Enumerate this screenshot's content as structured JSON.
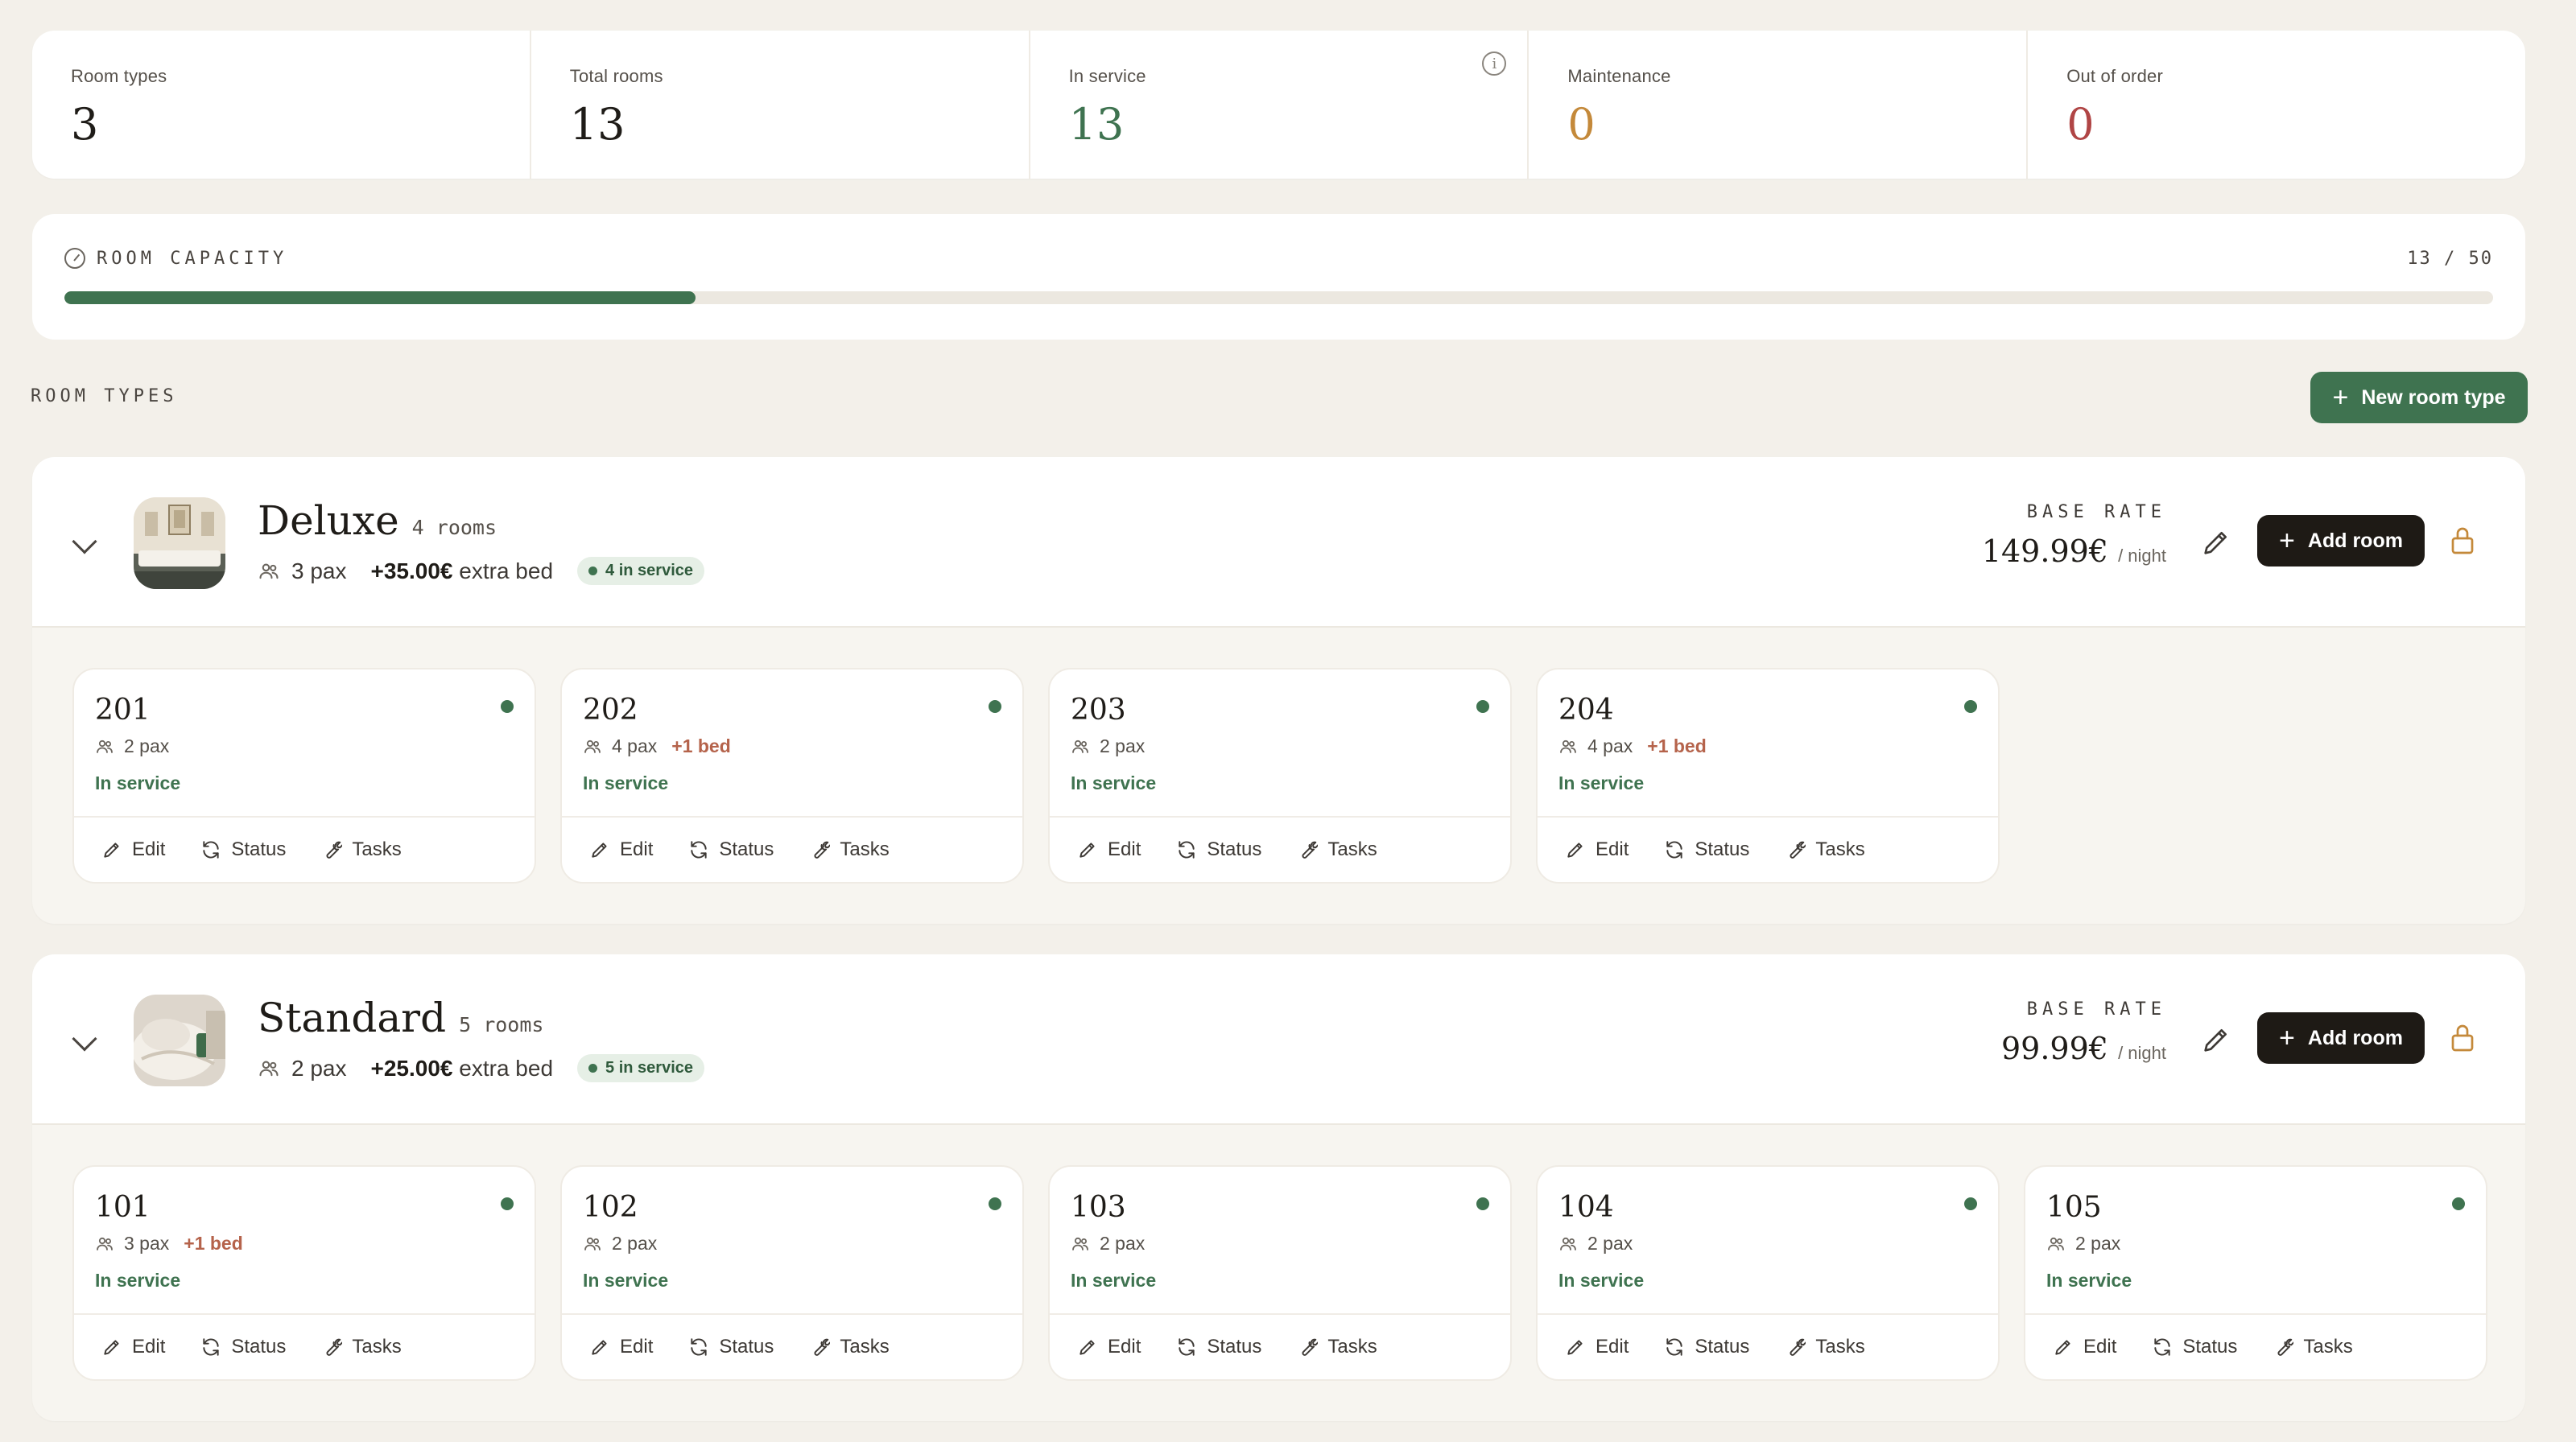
{
  "stats": [
    {
      "label": "Room types",
      "value": "3",
      "color": "#1f1c18"
    },
    {
      "label": "Total rooms",
      "value": "13",
      "color": "#1f1c18"
    },
    {
      "label": "In service",
      "value": "13",
      "color": "#3f7350"
    },
    {
      "label": "Maintenance",
      "value": "0",
      "color": "#c4893a"
    },
    {
      "label": "Out of order",
      "value": "0",
      "color": "#b04545"
    }
  ],
  "capacity": {
    "title": "ROOM CAPACITY",
    "count": "13 / 50",
    "fraction": 0.26,
    "color": "#3f7350"
  },
  "room_types_section": {
    "label": "ROOM TYPES",
    "new_button": "New room type"
  },
  "room_types": [
    {
      "name": "Deluxe",
      "count": "4 rooms",
      "pax": "3 pax",
      "extra_price": "+35.00€",
      "extra_label": "extra bed",
      "in_service": "4 in service",
      "rate_label": "BASE RATE",
      "rate": "149.99€",
      "per": "/ night",
      "add_button": "Add room",
      "rooms": [
        {
          "number": "201",
          "pax": "2 pax",
          "bed": "",
          "status": "In service"
        },
        {
          "number": "202",
          "pax": "4 pax",
          "bed": "+1 bed",
          "status": "In service"
        },
        {
          "number": "203",
          "pax": "2 pax",
          "bed": "",
          "status": "In service"
        },
        {
          "number": "204",
          "pax": "4 pax",
          "bed": "+1 bed",
          "status": "In service"
        }
      ]
    },
    {
      "name": "Standard",
      "count": "5 rooms",
      "pax": "2 pax",
      "extra_price": "+25.00€",
      "extra_label": "extra bed",
      "in_service": "5 in service",
      "rate_label": "BASE RATE",
      "rate": "99.99€",
      "per": "/ night",
      "add_button": "Add room",
      "rooms": [
        {
          "number": "101",
          "pax": "3 pax",
          "bed": "+1 bed",
          "status": "In service"
        },
        {
          "number": "102",
          "pax": "2 pax",
          "bed": "",
          "status": "In service"
        },
        {
          "number": "103",
          "pax": "2 pax",
          "bed": "",
          "status": "In service"
        },
        {
          "number": "104",
          "pax": "2 pax",
          "bed": "",
          "status": "In service"
        },
        {
          "number": "105",
          "pax": "2 pax",
          "bed": "",
          "status": "In service"
        }
      ]
    }
  ],
  "actions": {
    "edit": "Edit",
    "status": "Status",
    "tasks": "Tasks"
  },
  "icons": {
    "info": "info-icon",
    "capacity": "gauge-icon",
    "chevron": "chevron-down-icon",
    "people": "people-icon",
    "pencil": "pencil-icon",
    "lock": "lock-icon",
    "refresh": "refresh-icon",
    "wrench": "wrench-icon",
    "plus": "plus-icon"
  }
}
